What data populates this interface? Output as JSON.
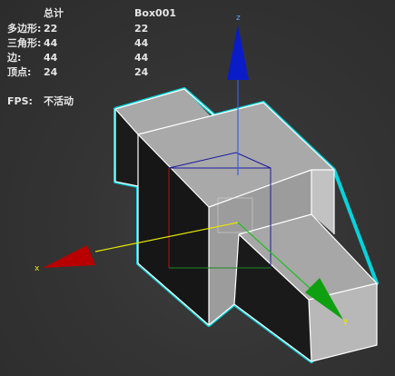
{
  "stats": {
    "header": {
      "total": "总计",
      "object": "Box001"
    },
    "rows": [
      {
        "label": "多边形:",
        "total": "22",
        "object": "22"
      },
      {
        "label": "三角形:",
        "total": "44",
        "object": "44"
      },
      {
        "label": "边:",
        "total": "44",
        "object": "44"
      },
      {
        "label": "顶点:",
        "total": "24",
        "object": "24"
      }
    ],
    "fps": {
      "label": "FPS:",
      "value": "不活动"
    }
  },
  "gizmo": {
    "x_label": "x",
    "y_label": "y",
    "z_label": "z",
    "x_color": "#c00000",
    "y_color": "#00a000",
    "z_color": "#0000c8"
  },
  "selection_color": "#00e5ee",
  "viewport_background": "#353535"
}
